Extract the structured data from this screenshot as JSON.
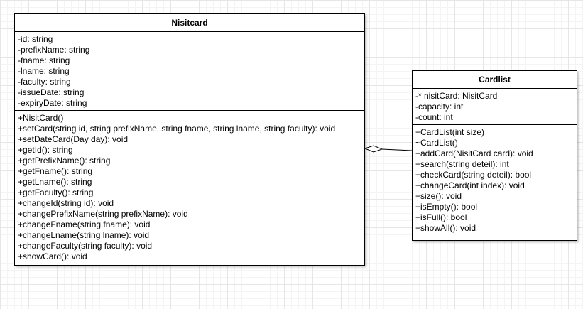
{
  "classes": {
    "nisitcard": {
      "name": "Nisitcard",
      "attributes": [
        "-id: string",
        "-prefixName: string",
        "-fname: string",
        "-lname: string",
        "-faculty: string",
        "-issueDate: string",
        "-expiryDate: string"
      ],
      "methods": [
        "+NisitCard()",
        "+setCard(string id, string prefixName, string fname, string lname, string faculty): void",
        "+setDateCard(Day day): void",
        "+getId(): string",
        "+getPrefixName(): string",
        "+getFname(): string",
        "+getLname(): string",
        "+getFaculty(): string",
        "+changeId(string id): void",
        "+changePrefixName(string prefixName): void",
        "+changeFname(string fname): void",
        "+changeLname(string lname): void",
        "+changeFaculty(string faculty): void",
        "+showCard(): void"
      ]
    },
    "cardlist": {
      "name": "Cardlist",
      "attributes": [
        "-* nisitCard: NisitCard",
        "-capacity: int",
        "-count: int"
      ],
      "methods": [
        "+CardList(int size)",
        "~CardList()",
        "+addCard(NisitCard card): void",
        "+search(string deteil): int",
        "+checkCard(string deteil): bool",
        "+changeCard(int index): void",
        "+size(): void",
        "+isEmpty(): bool",
        "+isFull(): bool",
        "+showAll(): void"
      ]
    }
  },
  "relationship": {
    "type": "aggregation",
    "whole": "cardlist",
    "part": "nisitcard",
    "diamond_fill": "#ffffff",
    "stroke": "#000000"
  }
}
